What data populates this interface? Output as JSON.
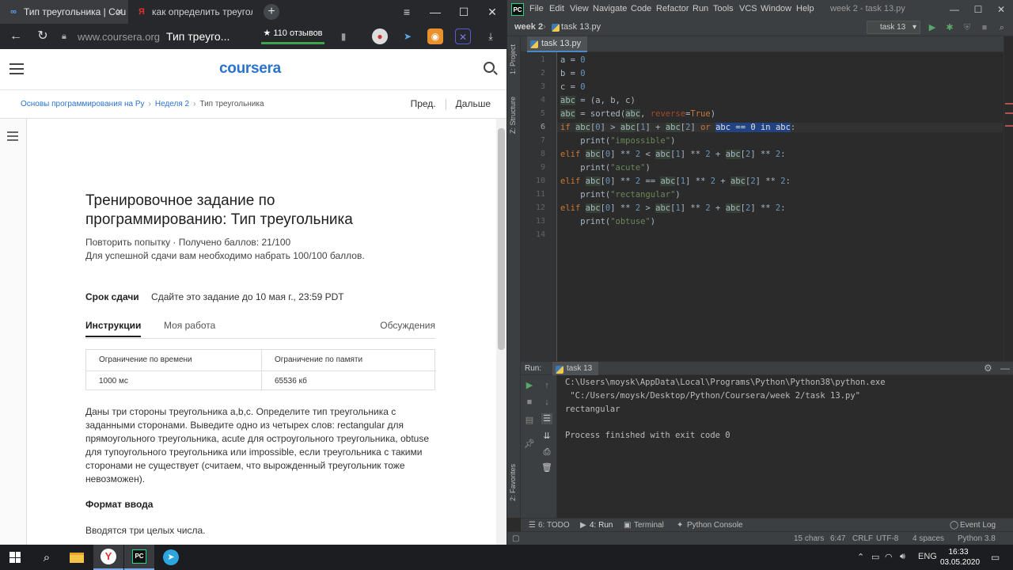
{
  "browser": {
    "tabs": [
      {
        "label": "Тип треугольника | Cou",
        "icon": "coursera-icon"
      },
      {
        "label": "как определить треугольн",
        "icon": "yandex-icon"
      }
    ],
    "url_host": "www.coursera.org",
    "url_title": "Тип треуго...",
    "reviews": "★ 110 отзывов"
  },
  "coursera": {
    "logo": "coursera",
    "breadcrumbs": [
      "Основы программирования на Ру",
      "Неделя 2",
      "Тип треугольника"
    ],
    "prev": "Пред.",
    "next": "Дальше",
    "title": "Тренировочное задание по программированию: Тип треугольника",
    "attempt": "Повторить попытку · Получено баллов: 21/100",
    "pass_req": "Для успешной сдачи вам необходимо набрать 100/100 баллов.",
    "deadline_label": "Срок сдачи",
    "deadline_value": "Сдайте это задание до 10 мая г., 23:59 PDT",
    "tabs": [
      "Инструкции",
      "Моя работа",
      "Обсуждения"
    ],
    "limits": {
      "time_header": "Ограничение по времени",
      "mem_header": "Ограничение по памяти",
      "time_value": "1000 мс",
      "mem_value": "65536 кб"
    },
    "task_text": "Даны три стороны треугольника a,b,c. Определите тип треугольника с заданными сторонами. Выведите одно из четырех слов: rectangular для прямоугольного треугольника, acute для остроугольного треугольника, obtuse для тупоугольного треугольника или impossible, если треугольника с такими сторонами не существует (считаем, что вырожденный треугольник тоже невозможен).",
    "input_format_h": "Формат ввода",
    "input_format_p": "Вводятся три целых числа."
  },
  "ide": {
    "menu": [
      "File",
      "Edit",
      "View",
      "Navigate",
      "Code",
      "Refactor",
      "Run",
      "Tools",
      "VCS",
      "Window",
      "Help"
    ],
    "window_title": "week 2 - task 13.py",
    "nav_project": "week 2",
    "nav_file": "task 13.py",
    "run_config": "task 13",
    "editor_tab": "task 13.py",
    "side_labels": {
      "project": "1: Project",
      "structure": "Z: Structure",
      "favorites": "2: Favorites"
    },
    "line_numbers": [
      "1",
      "2",
      "3",
      "4",
      "5",
      "6",
      "7",
      "8",
      "9",
      "10",
      "11",
      "12",
      "13",
      "14"
    ],
    "run_label": "Run:",
    "run_tab": "task 13",
    "console": [
      "C:\\Users\\moysk\\AppData\\Local\\Programs\\Python\\Python38\\python.exe",
      " \"C:/Users/moysk/Desktop/Python/Coursera/week 2/task 13.py\"",
      "rectangular",
      "",
      "Process finished with exit code 0"
    ],
    "toolwindows": [
      "6: TODO",
      "4: Run",
      "Terminal",
      "Python Console"
    ],
    "event_log": "Event Log",
    "status": [
      "15 chars",
      "6:47",
      "CRLF",
      "UTF-8",
      "4 spaces",
      "Python 3.8"
    ]
  },
  "taskbar": {
    "lang": "ENG",
    "time": "16:33",
    "date": "03.05.2020"
  }
}
